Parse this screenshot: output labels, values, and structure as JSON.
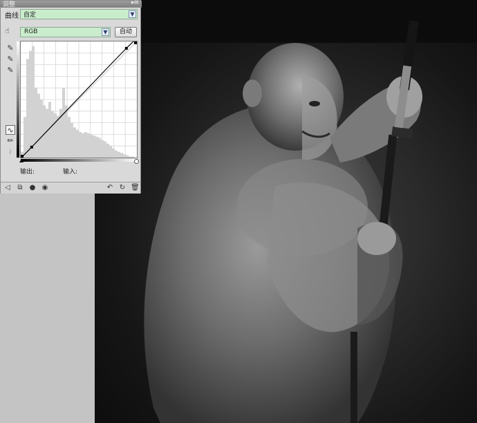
{
  "panel": {
    "title": "调整",
    "menu_glyph": "▸≡",
    "adjustment_type": "曲线",
    "preset": {
      "value": "自定"
    },
    "channel": {
      "value": "RGB"
    },
    "auto_button_label": "自动",
    "output_label": "输出:",
    "input_label": "输入:"
  },
  "chart_data": {
    "type": "line",
    "xlim": [
      0,
      255
    ],
    "ylim": [
      0,
      255
    ],
    "grid": true,
    "grid_divisions": 10,
    "series": [
      {
        "values_xy": [
          [
            0,
            0
          ],
          [
            24,
            23
          ],
          [
            232,
            240
          ],
          [
            255,
            255
          ]
        ]
      }
    ],
    "baseline": [
      [
        0,
        0
      ],
      [
        255,
        255
      ]
    ],
    "histogram": [
      0.05,
      0.35,
      0.85,
      0.92,
      0.96,
      0.6,
      0.55,
      0.5,
      0.45,
      0.42,
      0.48,
      0.4,
      0.38,
      0.36,
      0.42,
      0.6,
      0.45,
      0.35,
      0.3,
      0.26,
      0.24,
      0.22,
      0.21,
      0.22,
      0.21,
      0.2,
      0.19,
      0.18,
      0.17,
      0.15,
      0.14,
      0.12,
      0.1,
      0.08,
      0.06,
      0.05,
      0.04,
      0.03,
      0.02,
      0.01,
      0.01,
      0.0
    ]
  },
  "icons": {
    "hand": "hand-targeted-adjust-icon",
    "black_eyedropper": "eyedropper-black-icon",
    "gray_eyedropper": "eyedropper-gray-icon",
    "white_eyedropper": "eyedropper-white-icon",
    "curve_tool": "curve-point-tool-icon",
    "pencil_tool": "pencil-draw-icon",
    "smooth_tool": "smooth-curve-icon"
  },
  "colors": {
    "select_bg": "#c9eccd",
    "panel_bg": "#d9d9d9"
  }
}
